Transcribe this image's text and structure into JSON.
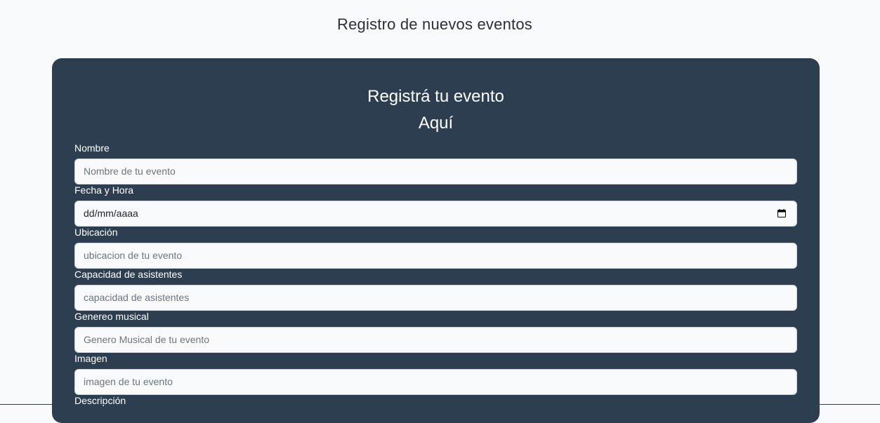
{
  "page": {
    "title": "Registro de nuevos eventos"
  },
  "form": {
    "heading_line1": "Registrá tu evento",
    "heading_line2": "Aquí",
    "fields": [
      {
        "label": "Nombre",
        "placeholder": "Nombre de tu evento"
      },
      {
        "label": "Fecha y Hora",
        "value": "dd/mm/aaaa",
        "icon": "calendar-icon"
      },
      {
        "label": "Ubicación",
        "placeholder": "ubicacion de tu evento"
      },
      {
        "label": "Capacidad de asistentes",
        "placeholder": "capacidad de asistentes"
      },
      {
        "label": "Genereo musical",
        "placeholder": "Genero Musical de tu evento"
      },
      {
        "label": "Imagen",
        "placeholder": "imagen de tu evento"
      },
      {
        "label": "Descripción"
      }
    ]
  },
  "colors": {
    "page_bg": "#f8fafc",
    "card_bg": "#2d3e50",
    "input_bg": "#f8fafc",
    "label_text": "#ffffff",
    "placeholder_text": "#6c757d"
  }
}
